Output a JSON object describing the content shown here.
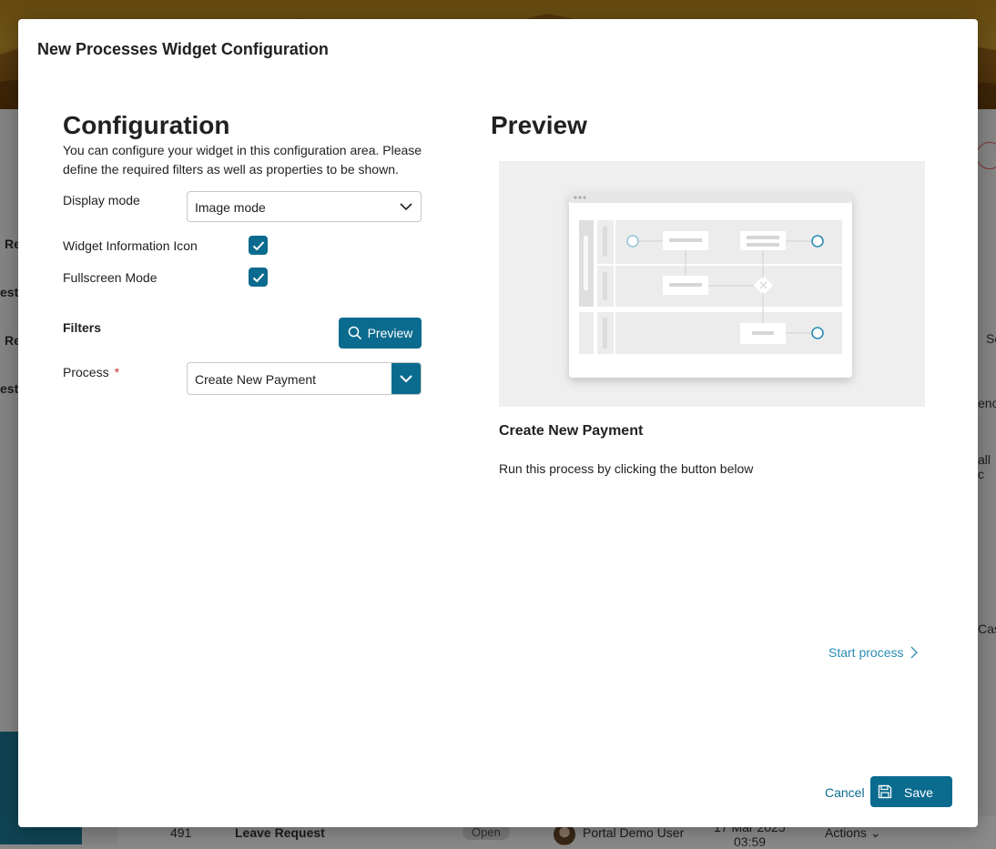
{
  "dialog": {
    "title": "New Processes Widget Configuration",
    "cancel_label": "Cancel",
    "save_label": "Save"
  },
  "configuration": {
    "heading": "Configuration",
    "description": "You can configure your widget in this configuration area. Please define the required filters as well as properties to be shown.",
    "display_mode": {
      "label": "Display mode",
      "value": "Image mode"
    },
    "widget_info_icon": {
      "label": "Widget Information Icon",
      "checked": true
    },
    "fullscreen_mode": {
      "label": "Fullscreen Mode",
      "checked": true
    },
    "filters_heading": "Filters",
    "preview_button_label": "Preview",
    "process": {
      "label": "Process",
      "required_mark": "*",
      "value": "Create New Payment"
    }
  },
  "preview": {
    "heading": "Preview",
    "process_name": "Create New Payment",
    "run_text": "Run this process by clicking the button below",
    "start_process_label": "Start process"
  },
  "background": {
    "row_labels": [
      "Re",
      "est",
      "Re",
      "est"
    ],
    "right_fragments": [
      "Se",
      "enc",
      "all c",
      "Cas"
    ],
    "table_row": {
      "id": "491",
      "name": "Leave Request",
      "state": "Open",
      "user": "Portal Demo User",
      "date": "17 Mar 2025",
      "time": "03:59",
      "actions_label": "Actions"
    }
  },
  "colors": {
    "primary": "#0b6b8f",
    "link": "#2a8db5",
    "required": "#d32f2f",
    "overlay": "rgba(0,0,0,0.45)"
  }
}
